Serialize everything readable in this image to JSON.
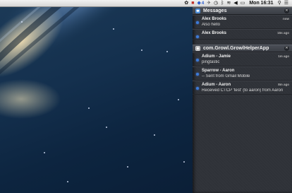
{
  "menubar": {
    "icons": [
      {
        "name": "growl-icon",
        "glyph": "✿"
      },
      {
        "name": "red-app-icon",
        "glyph": "■",
        "color": "#c0302a"
      },
      {
        "name": "dropbox-icon",
        "glyph": "◆",
        "color": "#2a5ccf",
        "badge": "4"
      },
      {
        "name": "messages-icon",
        "glyph": "✈",
        "color": "#555555"
      },
      {
        "name": "time-machine-icon",
        "glyph": "◷"
      },
      {
        "name": "bluetooth-icon",
        "glyph": "ᛒ"
      },
      {
        "name": "wifi-icon",
        "glyph": "≋"
      },
      {
        "name": "volume-icon",
        "glyph": "◀"
      },
      {
        "name": "battery-icon",
        "glyph": "▭"
      }
    ],
    "clock": "Mon 16:31",
    "search_icon": "⚲",
    "nc_icon": "☰"
  },
  "notification_center": {
    "groups": [
      {
        "app": "Messages",
        "icon_color": "#4f8fd8",
        "items": [
          {
            "title": "Alex Brooks",
            "time": "now",
            "body": "Also hello"
          },
          {
            "title": "Alex Brooks",
            "time": "15s ago",
            "body": ""
          }
        ]
      },
      {
        "app": "com.Growl.GrowlHelperApp",
        "icon_color": "#d8d8d8",
        "items": [
          {
            "title": "Adium - Jamie",
            "time": "1m ago",
            "body": "pingtastic"
          },
          {
            "title": "Sparrow - Aaron",
            "time": "",
            "body": "-- Sent from Gmail Mobile"
          },
          {
            "title": "Adium - Aaron",
            "time": "8m ago",
            "body": "Received CTCP 'test' (to aaron) from Aaron"
          }
        ]
      }
    ]
  },
  "colors": {
    "unread_dot": "#3d7bd9",
    "panel_bg": "#2f3238"
  }
}
